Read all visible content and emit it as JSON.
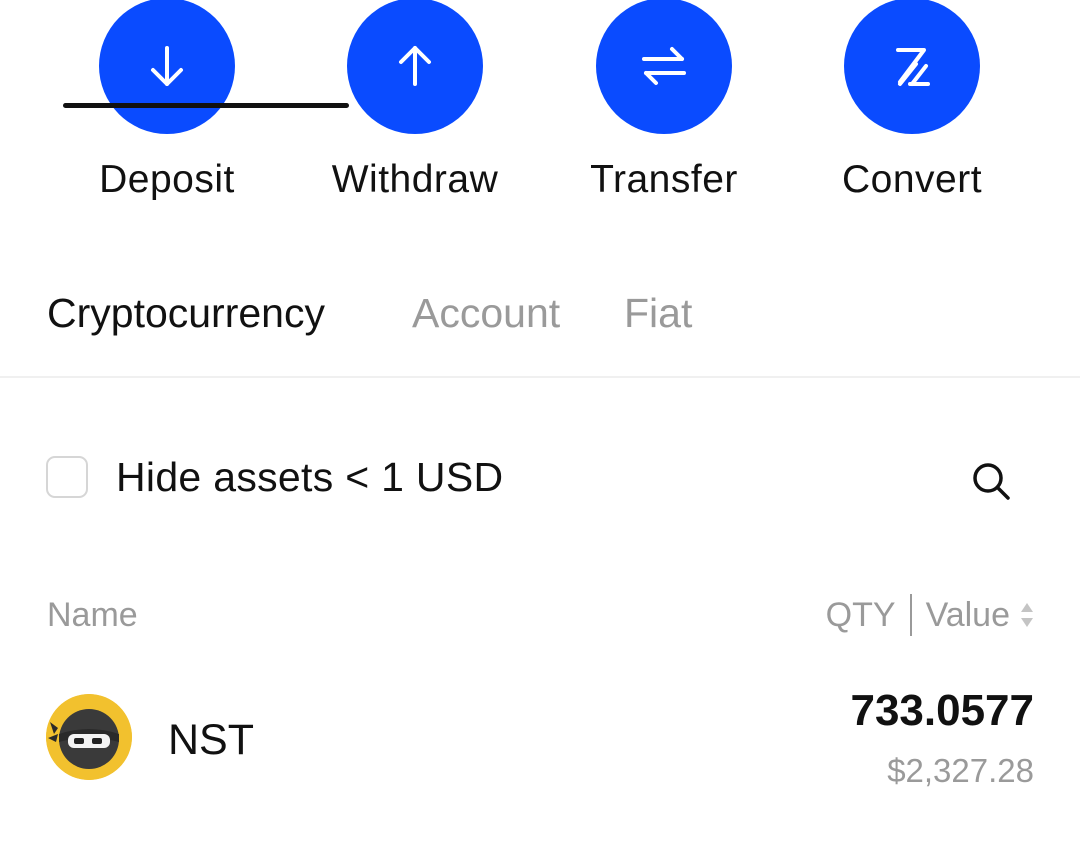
{
  "actions": [
    {
      "label": "Deposit",
      "icon": "arrow-down-icon"
    },
    {
      "label": "Withdraw",
      "icon": "arrow-up-icon"
    },
    {
      "label": "Transfer",
      "icon": "transfer-arrows-icon"
    },
    {
      "label": "Convert",
      "icon": "convert-icon"
    }
  ],
  "colors": {
    "accent": "#0a4bff",
    "text_primary": "#111111",
    "text_secondary": "#9a9a9a",
    "avatar_bg": "#f2c12e"
  },
  "tabs": [
    {
      "label": "Cryptocurrency",
      "active": true
    },
    {
      "label": "Account",
      "active": false
    },
    {
      "label": "Fiat",
      "active": false
    }
  ],
  "filter": {
    "hide_small_label": "Hide assets < 1 USD",
    "checked": false
  },
  "columns": {
    "name": "Name",
    "qty": "QTY",
    "value": "Value"
  },
  "assets": [
    {
      "symbol": "NST",
      "qty": "733.0577",
      "value": "$2,327.28",
      "icon": "ninja-token-icon"
    }
  ]
}
